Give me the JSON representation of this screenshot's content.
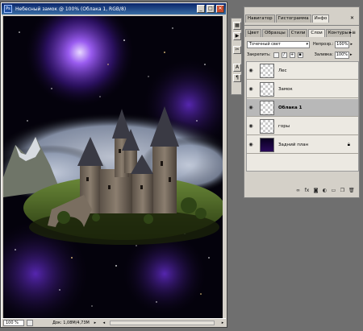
{
  "document": {
    "title": "Небесный замок @ 100% (Облака 1, RGB/8)",
    "app_icon": "Ps",
    "window_buttons": [
      "_",
      "□",
      "✕"
    ],
    "zoom": "100 %",
    "doc_info": "Док: 1,08M/4,73M"
  },
  "toolstrip": {
    "icons": [
      "history-icon",
      "play-icon",
      "tools-icon",
      "text-icon",
      "paragraph-icon"
    ]
  },
  "panels": {
    "top_tabs": [
      "Навигатор",
      "Гистограмма",
      "Инфо"
    ],
    "top_tabs_close": "✕",
    "layers_tabs": [
      "Цвет",
      "Образцы",
      "Стили",
      "Слои",
      "Контуры"
    ],
    "layers_tabs_close": "✕",
    "blend_mode": "Точечный свет",
    "opacity_label": "Непрозр.:",
    "opacity_value": "100%",
    "lock_label": "Закрепить:",
    "fill_label": "Заливка:",
    "fill_value": "100%",
    "layers": [
      {
        "name": "Лес",
        "selected": false,
        "locked": false
      },
      {
        "name": "Замок",
        "selected": false,
        "locked": false
      },
      {
        "name": "Облака 1",
        "selected": true,
        "locked": false
      },
      {
        "name": "горы",
        "selected": false,
        "locked": false
      },
      {
        "name": "Задний план",
        "selected": false,
        "locked": true
      }
    ]
  },
  "colors": {
    "titlebar": "#0a246a",
    "selected_layer": "#b8b8b8",
    "space": "#000000",
    "nebula": "#7a3bd0"
  }
}
